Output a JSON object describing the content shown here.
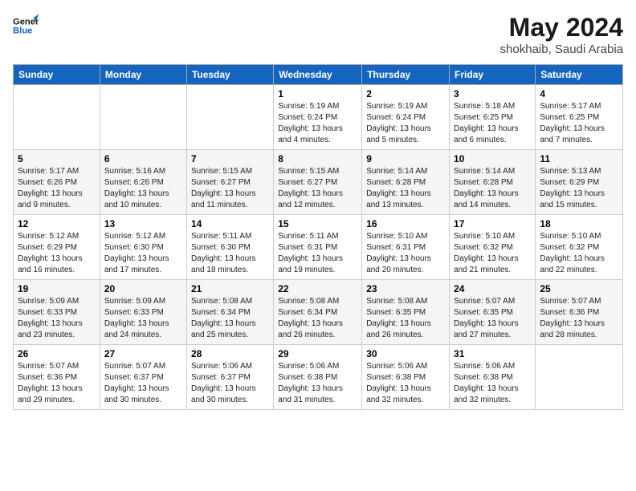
{
  "header": {
    "logo_line1": "General",
    "logo_line2": "Blue",
    "month_year": "May 2024",
    "location": "shokhaib, Saudi Arabia"
  },
  "weekdays": [
    "Sunday",
    "Monday",
    "Tuesday",
    "Wednesday",
    "Thursday",
    "Friday",
    "Saturday"
  ],
  "weeks": [
    [
      {
        "day": "",
        "info": ""
      },
      {
        "day": "",
        "info": ""
      },
      {
        "day": "",
        "info": ""
      },
      {
        "day": "1",
        "info": "Sunrise: 5:19 AM\nSunset: 6:24 PM\nDaylight: 13 hours\nand 4 minutes."
      },
      {
        "day": "2",
        "info": "Sunrise: 5:19 AM\nSunset: 6:24 PM\nDaylight: 13 hours\nand 5 minutes."
      },
      {
        "day": "3",
        "info": "Sunrise: 5:18 AM\nSunset: 6:25 PM\nDaylight: 13 hours\nand 6 minutes."
      },
      {
        "day": "4",
        "info": "Sunrise: 5:17 AM\nSunset: 6:25 PM\nDaylight: 13 hours\nand 7 minutes."
      }
    ],
    [
      {
        "day": "5",
        "info": "Sunrise: 5:17 AM\nSunset: 6:26 PM\nDaylight: 13 hours\nand 9 minutes."
      },
      {
        "day": "6",
        "info": "Sunrise: 5:16 AM\nSunset: 6:26 PM\nDaylight: 13 hours\nand 10 minutes."
      },
      {
        "day": "7",
        "info": "Sunrise: 5:15 AM\nSunset: 6:27 PM\nDaylight: 13 hours\nand 11 minutes."
      },
      {
        "day": "8",
        "info": "Sunrise: 5:15 AM\nSunset: 6:27 PM\nDaylight: 13 hours\nand 12 minutes."
      },
      {
        "day": "9",
        "info": "Sunrise: 5:14 AM\nSunset: 6:28 PM\nDaylight: 13 hours\nand 13 minutes."
      },
      {
        "day": "10",
        "info": "Sunrise: 5:14 AM\nSunset: 6:28 PM\nDaylight: 13 hours\nand 14 minutes."
      },
      {
        "day": "11",
        "info": "Sunrise: 5:13 AM\nSunset: 6:29 PM\nDaylight: 13 hours\nand 15 minutes."
      }
    ],
    [
      {
        "day": "12",
        "info": "Sunrise: 5:12 AM\nSunset: 6:29 PM\nDaylight: 13 hours\nand 16 minutes."
      },
      {
        "day": "13",
        "info": "Sunrise: 5:12 AM\nSunset: 6:30 PM\nDaylight: 13 hours\nand 17 minutes."
      },
      {
        "day": "14",
        "info": "Sunrise: 5:11 AM\nSunset: 6:30 PM\nDaylight: 13 hours\nand 18 minutes."
      },
      {
        "day": "15",
        "info": "Sunrise: 5:11 AM\nSunset: 6:31 PM\nDaylight: 13 hours\nand 19 minutes."
      },
      {
        "day": "16",
        "info": "Sunrise: 5:10 AM\nSunset: 6:31 PM\nDaylight: 13 hours\nand 20 minutes."
      },
      {
        "day": "17",
        "info": "Sunrise: 5:10 AM\nSunset: 6:32 PM\nDaylight: 13 hours\nand 21 minutes."
      },
      {
        "day": "18",
        "info": "Sunrise: 5:10 AM\nSunset: 6:32 PM\nDaylight: 13 hours\nand 22 minutes."
      }
    ],
    [
      {
        "day": "19",
        "info": "Sunrise: 5:09 AM\nSunset: 6:33 PM\nDaylight: 13 hours\nand 23 minutes."
      },
      {
        "day": "20",
        "info": "Sunrise: 5:09 AM\nSunset: 6:33 PM\nDaylight: 13 hours\nand 24 minutes."
      },
      {
        "day": "21",
        "info": "Sunrise: 5:08 AM\nSunset: 6:34 PM\nDaylight: 13 hours\nand 25 minutes."
      },
      {
        "day": "22",
        "info": "Sunrise: 5:08 AM\nSunset: 6:34 PM\nDaylight: 13 hours\nand 26 minutes."
      },
      {
        "day": "23",
        "info": "Sunrise: 5:08 AM\nSunset: 6:35 PM\nDaylight: 13 hours\nand 26 minutes."
      },
      {
        "day": "24",
        "info": "Sunrise: 5:07 AM\nSunset: 6:35 PM\nDaylight: 13 hours\nand 27 minutes."
      },
      {
        "day": "25",
        "info": "Sunrise: 5:07 AM\nSunset: 6:36 PM\nDaylight: 13 hours\nand 28 minutes."
      }
    ],
    [
      {
        "day": "26",
        "info": "Sunrise: 5:07 AM\nSunset: 6:36 PM\nDaylight: 13 hours\nand 29 minutes."
      },
      {
        "day": "27",
        "info": "Sunrise: 5:07 AM\nSunset: 6:37 PM\nDaylight: 13 hours\nand 30 minutes."
      },
      {
        "day": "28",
        "info": "Sunrise: 5:06 AM\nSunset: 6:37 PM\nDaylight: 13 hours\nand 30 minutes."
      },
      {
        "day": "29",
        "info": "Sunrise: 5:06 AM\nSunset: 6:38 PM\nDaylight: 13 hours\nand 31 minutes."
      },
      {
        "day": "30",
        "info": "Sunrise: 5:06 AM\nSunset: 6:38 PM\nDaylight: 13 hours\nand 32 minutes."
      },
      {
        "day": "31",
        "info": "Sunrise: 5:06 AM\nSunset: 6:38 PM\nDaylight: 13 hours\nand 32 minutes."
      },
      {
        "day": "",
        "info": ""
      }
    ]
  ]
}
